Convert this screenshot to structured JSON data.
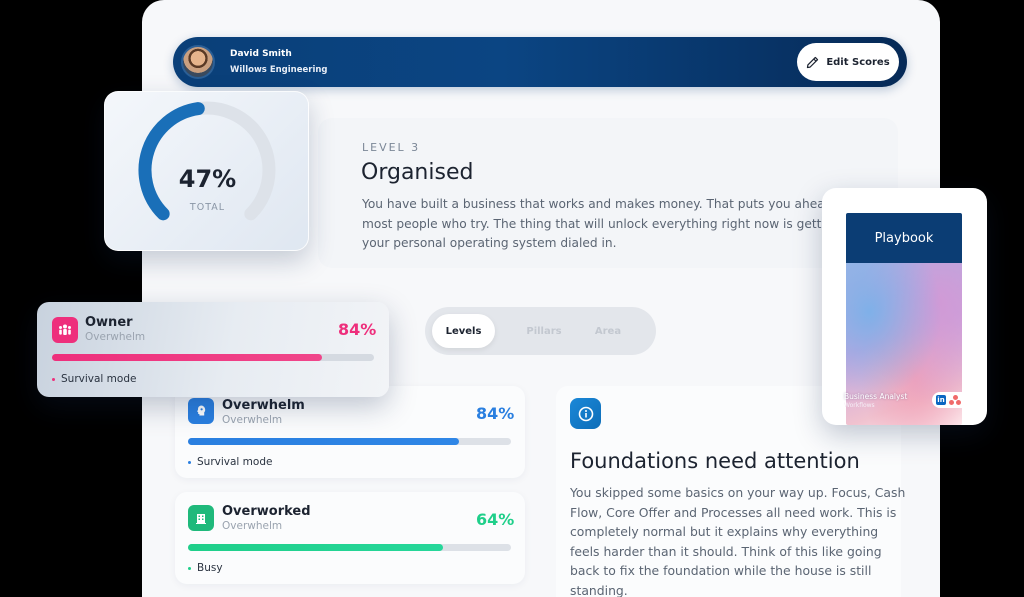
{
  "header": {
    "user_name": "David Smith",
    "company": "Willows Engineering",
    "edit_button": "Edit Scores"
  },
  "gauge": {
    "value": "47%",
    "label": "TOTAL",
    "fraction": 0.47
  },
  "level": {
    "label": "LEVEL 3",
    "title": "Organised",
    "description_lines": [
      "You have built a business that works and makes money. That puts you ahead of",
      "most people who try. The thing that will unlock everything right now is getting",
      "your personal operating system dialed in."
    ]
  },
  "tabs": [
    {
      "label": "Levels",
      "active": true
    },
    {
      "label": "Pillars",
      "active": false
    },
    {
      "label": "Area",
      "active": false
    }
  ],
  "scores": {
    "owner": {
      "title": "Owner",
      "subtitle": "Overwhelm",
      "percent": "84%",
      "fraction": 0.84,
      "status": "Survival mode",
      "color": "#ee2f7c"
    },
    "overwhelm": {
      "title": "Overwhelm",
      "subtitle": "Overwhelm",
      "percent": "84%",
      "fraction": 0.84,
      "status": "Survival mode",
      "color": "#2a7fe0"
    },
    "overworked": {
      "title": "Overworked",
      "subtitle": "Overwhelm",
      "percent": "64%",
      "fraction": 0.79,
      "status": "Busy",
      "color": "#1fcf8a"
    }
  },
  "info": {
    "title": "Foundations need attention",
    "lines": [
      "You skipped some basics on your way up. Focus, Cash",
      "Flow, Core Offer and Processes all need work. This is",
      "completely normal but it explains why everything",
      "feels harder than it should. Think of this like going",
      "back to fix the foundation while the house is still",
      "standing."
    ]
  },
  "playbook": {
    "title": "Playbook",
    "role": "Business Analyst",
    "company": "Workflows",
    "linkedin": "in"
  }
}
